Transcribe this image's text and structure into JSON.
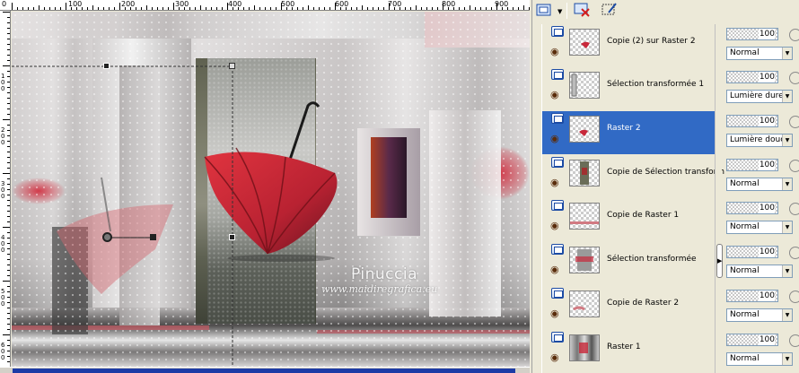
{
  "ruler": {
    "top_labels": [
      "0",
      "100",
      "200",
      "300",
      "400",
      "500",
      "600",
      "700",
      "800",
      "900"
    ],
    "left_labels": [
      "100",
      "200",
      "300",
      "400",
      "500",
      "600"
    ]
  },
  "canvas": {
    "watermark_title": "Pinuccia",
    "watermark_url": "www.maidiregrafica.eu"
  },
  "layers_panel": {
    "layers": [
      {
        "name": "Copie (2) sur Raster 2",
        "opacity": 100,
        "blend": "Normal",
        "selected": false
      },
      {
        "name": "Sélection transformée 1",
        "opacity": 100,
        "blend": "Lumière dure",
        "selected": false
      },
      {
        "name": "Raster 2",
        "opacity": 100,
        "blend": "Lumière douce",
        "selected": true
      },
      {
        "name": "Copie de Sélection transform",
        "opacity": 100,
        "blend": "Normal",
        "selected": false
      },
      {
        "name": "Copie de Raster 1",
        "opacity": 100,
        "blend": "Normal",
        "selected": false
      },
      {
        "name": "Sélection transformée",
        "opacity": 100,
        "blend": "Normal",
        "selected": false
      },
      {
        "name": "Copie de Raster 2",
        "opacity": 100,
        "blend": "Normal",
        "selected": false
      },
      {
        "name": "Raster 1",
        "opacity": 100,
        "blend": "Normal",
        "selected": false
      }
    ]
  },
  "colors": {
    "selection": "#316ac5",
    "panel": "#ece9d8",
    "umbrella_red": "#c8283a"
  }
}
